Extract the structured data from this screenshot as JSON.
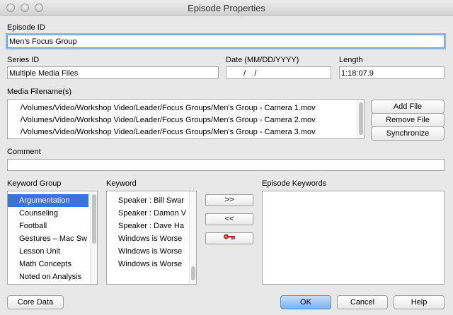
{
  "window": {
    "title": "Episode Properties"
  },
  "episode_id": {
    "label": "Episode ID",
    "value": "Men's Focus Group"
  },
  "series_id": {
    "label": "Series ID",
    "value": "Multiple Media Files"
  },
  "date": {
    "label": "Date (MM/DD/YYYY)",
    "value": "  /    /"
  },
  "length": {
    "label": "Length",
    "value": "1:18:07.9"
  },
  "media": {
    "label": "Media Filename(s)",
    "files": [
      "/Volumes/Video/Workshop Video/Leader/Focus Groups/Men's Group - Camera 1.mov",
      "/Volumes/Video/Workshop Video/Leader/Focus Groups/Men's Group - Camera 2.mov",
      "/Volumes/Video/Workshop Video/Leader/Focus Groups/Men's Group - Camera 3.mov"
    ],
    "buttons": {
      "add": "Add File",
      "remove": "Remove File",
      "sync": "Synchronize"
    }
  },
  "comment": {
    "label": "Comment",
    "value": ""
  },
  "keyword_group": {
    "label": "Keyword Group",
    "items": [
      "Argumentation",
      "Counseling",
      "Football",
      "Gestures – Mac Sw",
      "Lesson Unit",
      "Math Concepts",
      "Noted on Analysis"
    ],
    "selected_index": 0
  },
  "keyword": {
    "label": "Keyword",
    "items": [
      "Speaker : Bill Swar",
      "Speaker : Damon V",
      "Speaker : Dave Ha",
      "Windows is Worse",
      "Windows is Worse",
      "Windows is Worse"
    ]
  },
  "transfer": {
    "add": ">>",
    "remove": "<<",
    "key_icon": "key-icon",
    "key_color": "#cc1f1f"
  },
  "episode_keywords": {
    "label": "Episode Keywords",
    "items": []
  },
  "buttons": {
    "core_data": "Core Data",
    "ok": "OK",
    "cancel": "Cancel",
    "help": "Help"
  },
  "colors": {
    "selection": "#3875d7",
    "focus_ring": "#8fb7e6",
    "primary_button": "#79b0ec"
  }
}
